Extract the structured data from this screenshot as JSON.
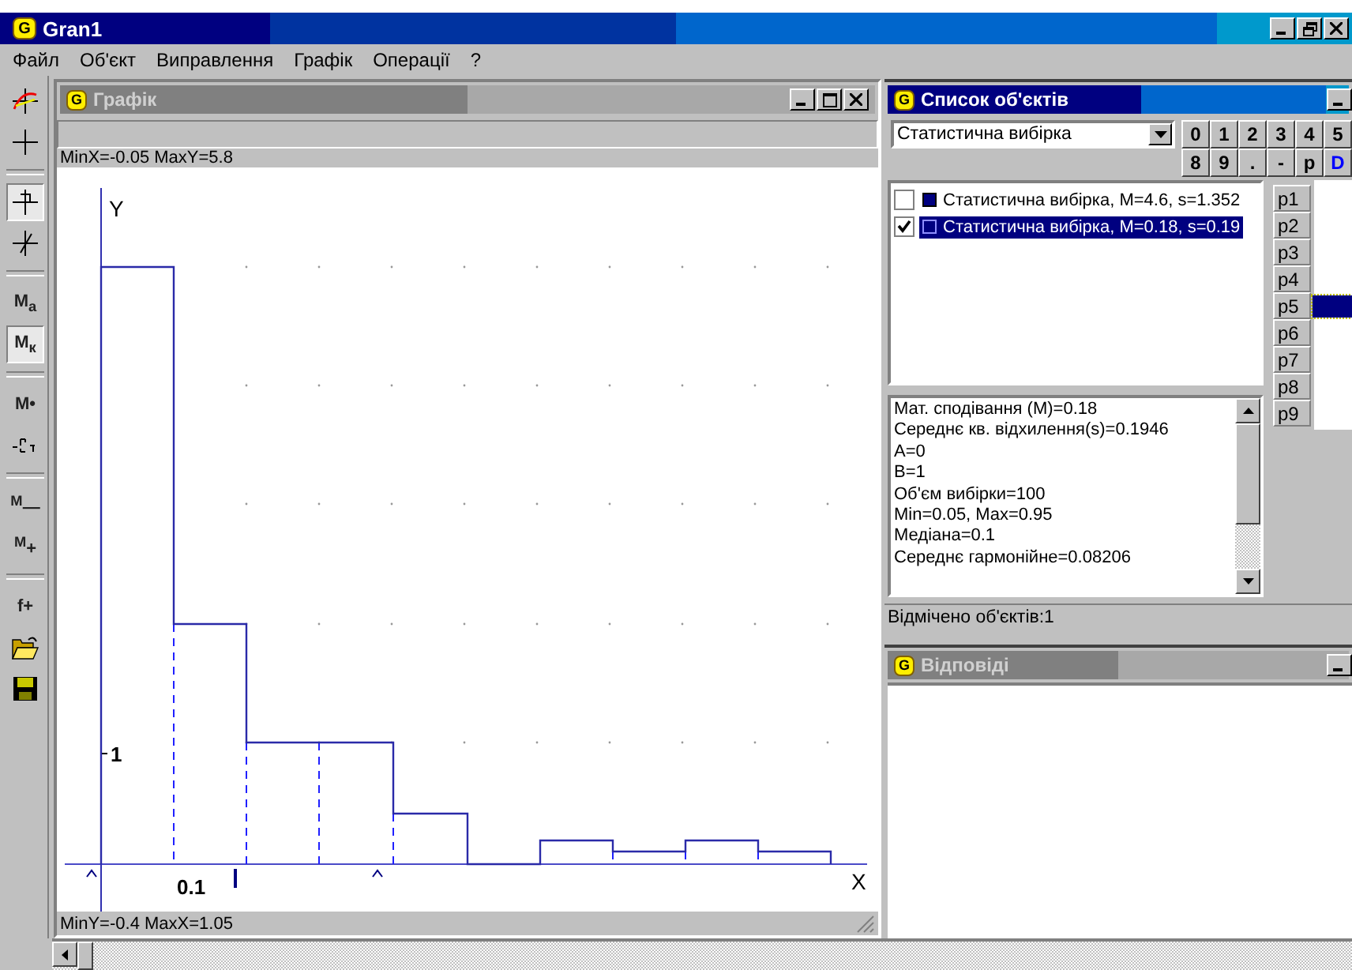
{
  "window": {
    "title": "Gran1",
    "logo": "G"
  },
  "menu": [
    "Файл",
    "Об'єкт",
    "Виправлення",
    "Графік",
    "Операції",
    "?"
  ],
  "toolbar": [
    {
      "kind": "axes",
      "pressed": false
    },
    {
      "kind": "plus",
      "pressed": false
    },
    {
      "kind": "crosshair",
      "pressed": true
    },
    {
      "kind": "slant",
      "pressed": false
    },
    {
      "kind": "text",
      "label": "M$_{a}$",
      "pressed": false
    },
    {
      "kind": "text",
      "label": "M$_{к}$",
      "pressed": true
    },
    {
      "kind": "text",
      "label": "M•",
      "pressed": false
    },
    {
      "kind": "scale",
      "pressed": false
    },
    {
      "kind": "text",
      "label": "$^{M}$—",
      "pressed": false
    },
    {
      "kind": "text",
      "label": "$^{M}$+",
      "pressed": false
    },
    {
      "kind": "text",
      "label": "f+",
      "pressed": false
    },
    {
      "kind": "folder",
      "pressed": false
    },
    {
      "kind": "floppy",
      "pressed": false
    }
  ],
  "graph_window": {
    "title": "Графік",
    "logo": "G",
    "top_info": "MinX=-0.05  MaxY=5.8",
    "bottom_info": "MinY=-0.4  MaxX=1.05",
    "y_axis_label": "Y",
    "x_axis_label": "X",
    "y_tick": "1",
    "x_tick": "0.1"
  },
  "objects_window": {
    "title": "Список об'єктів",
    "logo": "G",
    "type_select": {
      "value": "Статистична вибірка"
    },
    "keys": [
      [
        {
          "label": "0",
          "kind": "plain"
        },
        {
          "label": "1",
          "kind": "plain"
        },
        {
          "label": "2",
          "kind": "plain"
        },
        {
          "label": "3",
          "kind": "plain"
        },
        {
          "label": "4",
          "kind": "plain"
        },
        {
          "label": "5",
          "kind": "plain"
        }
      ],
      [
        {
          "label": "8",
          "kind": "plain"
        },
        {
          "label": "9",
          "kind": "plain"
        },
        {
          "label": ".",
          "kind": "plain"
        },
        {
          "label": "-",
          "kind": "plain"
        },
        {
          "label": "p",
          "kind": "plain"
        },
        {
          "label": "D",
          "kind": "special"
        }
      ]
    ],
    "objects": [
      {
        "label": "Статистична вибірка, M=4.6, s=1.352",
        "checked": false,
        "selected": false,
        "color": "#000080"
      },
      {
        "label": "Статистична вибірка, M=0.18, s=0.19",
        "checked": true,
        "selected": true,
        "color": "#000080"
      }
    ],
    "points": [
      {
        "label": "p1",
        "selected": false
      },
      {
        "label": "p2",
        "selected": false
      },
      {
        "label": "p3",
        "selected": false
      },
      {
        "label": "p4",
        "selected": false
      },
      {
        "label": "p5",
        "selected": true
      },
      {
        "label": "p6",
        "selected": false
      },
      {
        "label": "p7",
        "selected": false
      },
      {
        "label": "p8",
        "selected": false
      },
      {
        "label": "p9",
        "selected": false
      }
    ],
    "info_lines": [
      "Мат. сподівання (M)=0.18",
      "Середнє кв. відхилення(s)=0.1946",
      "A=0",
      "B=1",
      "Об'єм вибірки=100",
      "Min=0.05, Max=0.95",
      "Медіана=0.1",
      "Середнє гармонійне=0.08206"
    ],
    "status": "Відмічено об'єктів:1"
  },
  "answers_window": {
    "title": "Відповіді",
    "logo": "G"
  }
}
